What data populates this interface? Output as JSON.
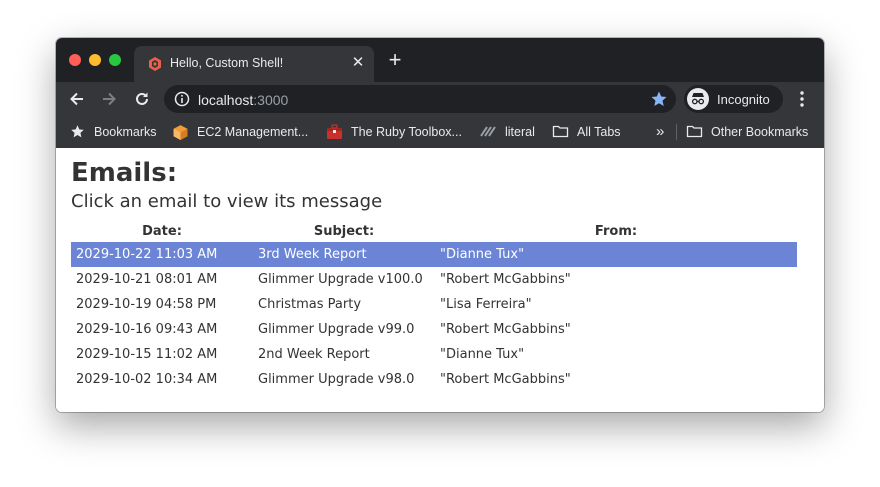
{
  "browser": {
    "tab_title": "Hello, Custom Shell!",
    "url_host": "localhost",
    "url_port": ":3000",
    "profile_label": "Incognito",
    "bookmarks": [
      {
        "label": "Bookmarks",
        "icon": "star-icon"
      },
      {
        "label": "EC2 Management...",
        "icon": "aws-cube-icon"
      },
      {
        "label": "The Ruby Toolbox...",
        "icon": "ruby-toolbox-icon"
      },
      {
        "label": "literal",
        "icon": "literal-icon"
      },
      {
        "label": "All Tabs",
        "icon": "folder-icon"
      }
    ],
    "overflow_label": "»",
    "other_bookmarks": "Other Bookmarks"
  },
  "page": {
    "title": "Emails:",
    "subtitle": "Click an email to view its message",
    "columns": [
      "Date:",
      "Subject:",
      "From:"
    ],
    "emails": [
      {
        "date": "2029-10-22 11:03 AM",
        "subject": "3rd Week Report",
        "from": "\"Dianne Tux\"",
        "selected": true
      },
      {
        "date": "2029-10-21 08:01 AM",
        "subject": "Glimmer Upgrade v100.0",
        "from": "\"Robert McGabbins\"",
        "selected": false
      },
      {
        "date": "2029-10-19 04:58 PM",
        "subject": "Christmas Party",
        "from": "\"Lisa Ferreira\"",
        "selected": false
      },
      {
        "date": "2029-10-16 09:43 AM",
        "subject": "Glimmer Upgrade v99.0",
        "from": "\"Robert McGabbins\"",
        "selected": false
      },
      {
        "date": "2029-10-15 11:02 AM",
        "subject": "2nd Week Report",
        "from": "\"Dianne Tux\"",
        "selected": false
      },
      {
        "date": "2029-10-02 10:34 AM",
        "subject": "Glimmer Upgrade v98.0",
        "from": "\"Robert McGabbins\"",
        "selected": false
      }
    ],
    "selection_color": "#6b84d6"
  }
}
